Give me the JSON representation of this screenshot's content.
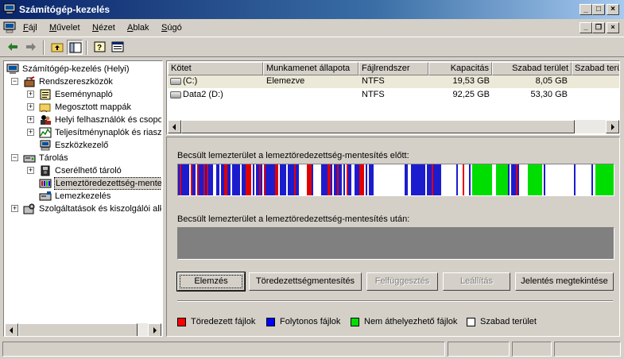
{
  "window": {
    "title": "Számítógép-kezelés",
    "controls": [
      "_",
      "□",
      "×"
    ]
  },
  "menu": {
    "items": [
      {
        "underline": "F",
        "rest": "ájl"
      },
      {
        "underline": "M",
        "rest": "űvelet"
      },
      {
        "underline": "N",
        "rest": "ézet"
      },
      {
        "underline": "A",
        "rest": "blak"
      },
      {
        "underline": "S",
        "rest": "úgó"
      }
    ]
  },
  "tree": {
    "items": [
      {
        "label": "Számítógép-kezelés (Helyi)",
        "icon": "computer-icon"
      },
      {
        "label": "Rendszereszközök",
        "icon": "tools-icon"
      },
      {
        "label": "Eseménynapló",
        "icon": "event-log-icon"
      },
      {
        "label": "Megosztott mappák",
        "icon": "shared-folder-icon"
      },
      {
        "label": "Helyi felhasználók és csoporto",
        "icon": "users-icon"
      },
      {
        "label": "Teljesítménynaplók és riasztás",
        "icon": "performance-icon"
      },
      {
        "label": "Eszközkezelő",
        "icon": "device-manager-icon"
      },
      {
        "label": "Tárolás",
        "icon": "storage-icon"
      },
      {
        "label": "Cserélhető tároló",
        "icon": "removable-storage-icon"
      },
      {
        "label": "Lemeztöredezettség-mentesítő",
        "icon": "defrag-icon"
      },
      {
        "label": "Lemezkezelés",
        "icon": "disk-management-icon"
      },
      {
        "label": "Szolgáltatások és kiszolgálói alkal",
        "icon": "services-icon"
      }
    ]
  },
  "volumes": {
    "columns": [
      "Kötet",
      "Munkamenet állapota",
      "Fájlrendszer",
      "Kapacitás",
      "Szabad terület",
      "Szabad terület"
    ],
    "rows": [
      {
        "volume": "(C:)",
        "status": "Elemezve",
        "fs": "NTFS",
        "capacity": "19,53 GB",
        "free": "8,05 GB"
      },
      {
        "volume": "Data2 (D:)",
        "status": "",
        "fs": "NTFS",
        "capacity": "92,25 GB",
        "free": "53,30 GB"
      }
    ]
  },
  "analysis": {
    "before_label": "Becsült lemezterület a lemeztöredezettség-mentesítés előtt:",
    "after_label": "Becsült lemezterület a lemeztöredezettség-mentesítés után:"
  },
  "buttons": {
    "analyze": "Elemzés",
    "defragment": "Töredezettségmentesítés",
    "pause": "Felfüggesztés",
    "stop": "Leállítás",
    "view_report": "Jelentés megtekintése"
  },
  "legend": [
    {
      "label": "Töredezett fájlok",
      "color": "#ff0000"
    },
    {
      "label": "Folytonos fájlok",
      "color": "#0000ff"
    },
    {
      "label": "Nem áthelyezhető fájlok",
      "color": "#00e000"
    },
    {
      "label": "Szabad terület",
      "color": "#ffffff"
    }
  ],
  "colors": {
    "fragmented": "#e00000",
    "contiguous": "#1c1ccf",
    "unmovable": "#00dd00",
    "free": "#ffffff"
  }
}
